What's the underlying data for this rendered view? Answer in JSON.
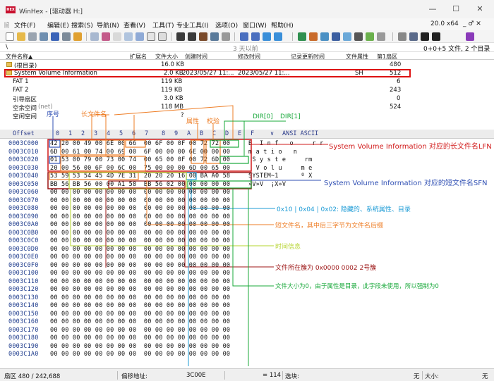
{
  "window": {
    "title": "WinHex - [驱动器 H:]",
    "app_icon_text": "HEX",
    "minimize": "—",
    "maximize": "☐",
    "close": "✕"
  },
  "menu": {
    "items": [
      "文件(F)",
      "编辑(E)",
      "搜索(S)",
      "导航(N)",
      "查看(V)",
      "工具(T)",
      "专业工具(I)",
      "选项(O)",
      "窗口(W)",
      "帮助(H)"
    ],
    "version": "20.0 x64",
    "right_controls": "_ ♂ ✕"
  },
  "path_bar": {
    "path": "\\",
    "center": "3 天以前",
    "summary": "0+0+5 文件, 2 个目录"
  },
  "file_list": {
    "columns": {
      "name": "文件名称▲",
      "ext": "扩展名",
      "size": "文件大小",
      "created": "创建时间",
      "modified": "修改时间",
      "record_updated": "记录更新时间",
      "attr": "文件属性",
      "first_sector": "第1扇区"
    },
    "rows": [
      {
        "name": "(根目录)",
        "ext": "",
        "size": "16.0 KB",
        "created": "",
        "modified": "",
        "attr": "",
        "sector": "480",
        "folder": true
      },
      {
        "name": "System Volume Information",
        "ext": "",
        "size": "2.0 KB",
        "created": "2023/05/27  11:...",
        "modified": "2023/05/27  11:...",
        "attr": "SH",
        "sector": "512",
        "folder": true
      },
      {
        "name": "FAT 1",
        "ext": "",
        "size": "119 KB",
        "created": "",
        "modified": "",
        "attr": "",
        "sector": "6",
        "folder": false
      },
      {
        "name": "FAT 2",
        "ext": "",
        "size": "119 KB",
        "created": "",
        "modified": "",
        "attr": "",
        "sector": "243",
        "folder": false
      },
      {
        "name": "引导扇区",
        "ext": "",
        "size": "3.0 KB",
        "created": "",
        "modified": "",
        "attr": "",
        "sector": "0",
        "folder": false
      },
      {
        "name": "空余空间",
        "name_suffix": "(net)",
        "ext": "",
        "size": "118 MB",
        "created": "",
        "modified": "",
        "attr": "",
        "sector": "524",
        "folder": false
      },
      {
        "name": "空闲空间",
        "ext": "",
        "size": "?",
        "created": "",
        "modified": "",
        "attr": "",
        "sector": "",
        "folder": false
      }
    ]
  },
  "hex_view": {
    "offset_header": "Offset",
    "column_headers": [
      "0",
      "1",
      "2",
      "3",
      "4",
      "5",
      "6",
      "7",
      "8",
      "9",
      "A",
      "B",
      "C",
      "D",
      "E",
      "F"
    ],
    "ansi_header": "ANSI ASCII",
    "ansi_dropdown": "∨",
    "rows": [
      {
        "offset": "0003C000",
        "hex": "42 20 00 49 00 6E 00 66  00 6F 00 0F 00 72 72 00",
        "ansi": "B  I n f   o     r r"
      },
      {
        "offset": "0003C010",
        "hex": "6D 00 61 00 74 00 69 00  6F 00 00 00 6E 00 00 00",
        "ansi": "m a t i o   n"
      },
      {
        "offset": "0003C020",
        "hex": "01 53 00 79 00 73 00 74  00 65 00 0F 00 72 6D 00",
        "ansi": " S y s t e     rm"
      },
      {
        "offset": "0003C030",
        "hex": "20 00 56 00 6F 00 6C 00  75 00 00 00 6D 00 65 00",
        "ansi": "  V o l u     m e"
      },
      {
        "offset": "0003C040",
        "hex": "53 59 53 54 45 4D 7E 31  20 20 20 16 00 BA A0 58",
        "ansi": "SYSTEM~1      º X"
      },
      {
        "offset": "0003C050",
        "hex": "BB 56 BB 56 00 00 A1 58  BB 56 02 00 00 00 00 00",
        "ansi": "»V»V  ¡X»V"
      },
      {
        "offset": "0003C060",
        "hex": "00 00 00 00 00 00 00 00  00 00 00 00 00 00 00 00",
        "ansi": ""
      },
      {
        "offset": "0003C070",
        "hex": "00 00 00 00 00 00 00 00  00 00 00 00 00 00 00 00",
        "ansi": ""
      },
      {
        "offset": "0003C080",
        "hex": "00 00 00 00 00 00 00 00  00 00 00 00 00 00 00 00",
        "ansi": ""
      },
      {
        "offset": "0003C090",
        "hex": "00 00 00 00 00 00 00 00  00 00 00 00 00 00 00 00",
        "ansi": ""
      },
      {
        "offset": "0003C0A0",
        "hex": "00 00 00 00 00 00 00 00  00 00 00 00 00 00 00 00",
        "ansi": ""
      },
      {
        "offset": "0003C0B0",
        "hex": "00 00 00 00 00 00 00 00  00 00 00 00 00 00 00 00",
        "ansi": ""
      },
      {
        "offset": "0003C0C0",
        "hex": "00 00 00 00 00 00 00 00  00 00 00 00 00 00 00 00",
        "ansi": ""
      },
      {
        "offset": "0003C0D0",
        "hex": "00 00 00 00 00 00 00 00  00 00 00 00 00 00 00 00",
        "ansi": ""
      },
      {
        "offset": "0003C0E0",
        "hex": "00 00 00 00 00 00 00 00  00 00 00 00 00 00 00 00",
        "ansi": ""
      },
      {
        "offset": "0003C0F0",
        "hex": "00 00 00 00 00 00 00 00  00 00 00 00 00 00 00 00",
        "ansi": ""
      },
      {
        "offset": "0003C100",
        "hex": "00 00 00 00 00 00 00 00  00 00 00 00 00 00 00 00",
        "ansi": ""
      },
      {
        "offset": "0003C110",
        "hex": "00 00 00 00 00 00 00 00  00 00 00 00 00 00 00 00",
        "ansi": ""
      },
      {
        "offset": "0003C120",
        "hex": "00 00 00 00 00 00 00 00  00 00 00 00 00 00 00 00",
        "ansi": ""
      },
      {
        "offset": "0003C130",
        "hex": "00 00 00 00 00 00 00 00  00 00 00 00 00 00 00 00",
        "ansi": ""
      },
      {
        "offset": "0003C140",
        "hex": "00 00 00 00 00 00 00 00  00 00 00 00 00 00 00 00",
        "ansi": ""
      },
      {
        "offset": "0003C150",
        "hex": "00 00 00 00 00 00 00 00  00 00 00 00 00 00 00 00",
        "ansi": ""
      },
      {
        "offset": "0003C160",
        "hex": "00 00 00 00 00 00 00 00  00 00 00 00 00 00 00 00",
        "ansi": ""
      },
      {
        "offset": "0003C170",
        "hex": "00 00 00 00 00 00 00 00  00 00 00 00 00 00 00 00",
        "ansi": ""
      },
      {
        "offset": "0003C180",
        "hex": "00 00 00 00 00 00 00 00  00 00 00 00 00 00 00 00",
        "ansi": ""
      },
      {
        "offset": "0003C190",
        "hex": "00 00 00 00 00 00 00 00  00 00 00 00 00 00 00 00",
        "ansi": ""
      },
      {
        "offset": "0003C1A0",
        "hex": "00 00 00 00 00 00 00 00  00 00 00 00 00 00 00 00",
        "ansi": ""
      }
    ]
  },
  "annotations": {
    "seq_no": "序号",
    "long_name": "长文件名",
    "attribute": "属性",
    "checksum": "校验",
    "dir0": "DIR[0]",
    "dir1": "DIR[1]",
    "lfn_note": "System Volume Information 对应的长文件名LFN",
    "sfn_note": "System Volume Information 对应的短文件名SFN",
    "attr_note": "0x10 | 0x04 | 0x02: 隐藏的、系统属性、目录",
    "short_name_note": "短文件名，其中后三字节为文件名后缀",
    "time_note": "时间信息",
    "cluster_note": "文件所在簇为 0x0000 0002 2号簇",
    "size_note": "文件大小为0，由于属性是目录，此字段未使用，所以强制为0",
    "colors": {
      "red": "#d11a1a",
      "orange": "#ee7d25",
      "blue": "#2f4fb3",
      "cyan": "#1c9bd6",
      "green": "#18a83a",
      "yellowgreen": "#b6d42e",
      "darkred": "#9c1414"
    }
  },
  "status_bar": {
    "sector": "扇区 480 / 242,688",
    "offset_label": "偏移地址:",
    "offset_value": "3C00E",
    "value": "= 114",
    "selection_label": "选块:",
    "right1": "无",
    "size_label": "大小:",
    "right2": "无"
  }
}
